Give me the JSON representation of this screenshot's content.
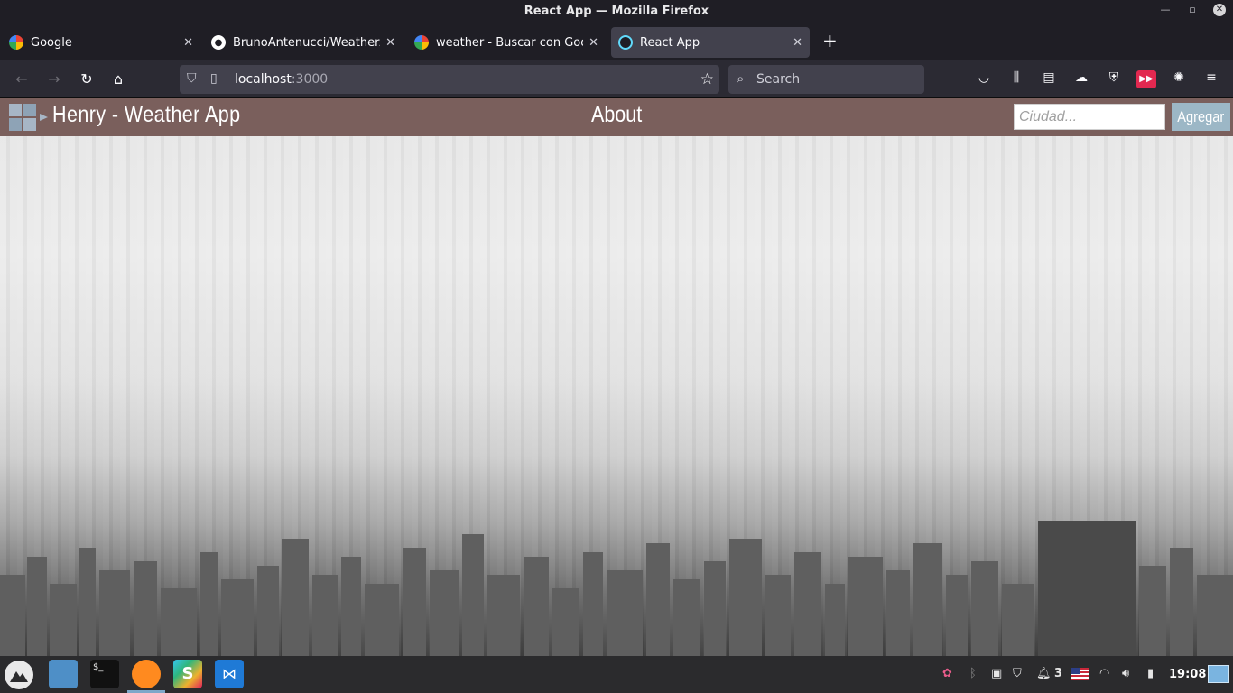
{
  "window": {
    "title": "React App — Mozilla Firefox"
  },
  "tabs": [
    {
      "label": "Google",
      "favicon": "google-icon"
    },
    {
      "label": "BrunoAntenucci/WeatherAp",
      "favicon": "github-icon"
    },
    {
      "label": "weather - Buscar con Google",
      "favicon": "google-icon"
    },
    {
      "label": "React App",
      "favicon": "react-icon",
      "active": true
    }
  ],
  "navbar": {
    "url_host": "localhost",
    "url_port": ":3000",
    "search_placeholder": "Search"
  },
  "app": {
    "title": "Henry - Weather App",
    "about_label": "About",
    "city_placeholder": "Ciudad...",
    "add_label": "Agregar",
    "nav_color": "#7a5f5c",
    "button_color": "#9cb7c6"
  },
  "taskbar": {
    "apps": [
      "menu-icon",
      "files-icon",
      "terminal-icon",
      "firefox-icon",
      "slack-icon",
      "vscode-icon"
    ],
    "notification_count": "3",
    "clock": "19:08"
  }
}
